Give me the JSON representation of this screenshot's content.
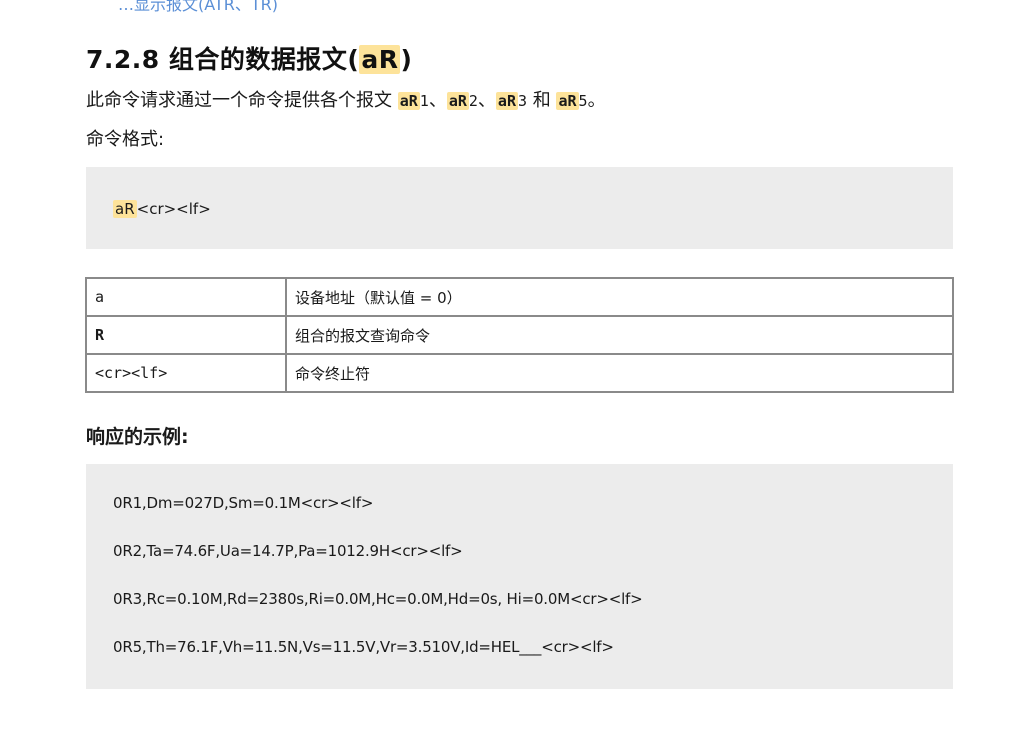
{
  "top_cut_text": "…显示报文(ATR、TR)",
  "heading": {
    "number": "7.2.8",
    "title_prefix": "组合的数据报文(",
    "title_code": "aR",
    "title_suffix": ")"
  },
  "intro": {
    "text": "此命令请求通过一个命令提供各个报文",
    "commands": [
      {
        "code": "aR",
        "num": "1",
        "sep": "、"
      },
      {
        "code": "aR",
        "num": "2",
        "sep": "、"
      },
      {
        "code": "aR",
        "num": "3",
        "sep": " 和 "
      },
      {
        "code": "aR",
        "num": "5",
        "sep": "。"
      }
    ]
  },
  "format_label": "命令格式:",
  "command_format": {
    "code": "aR",
    "rest": "<cr><lf>"
  },
  "params_table": [
    {
      "param": "a",
      "desc": "设备地址（默认值 = 0）"
    },
    {
      "param": "R",
      "desc": "组合的报文查询命令"
    },
    {
      "param": "<cr><lf>",
      "desc": "命令终止符"
    }
  ],
  "response_label": "响应的示例:",
  "response_lines": [
    "0R1,Dm=027D,Sm=0.1M<cr><lf>",
    "0R2,Ta=74.6F,Ua=14.7P,Pa=1012.9H<cr><lf>",
    "0R3,Rc=0.10M,Rd=2380s,Ri=0.0M,Hc=0.0M,Hd=0s, Hi=0.0M<cr><lf>",
    "0R5,Th=76.1F,Vh=11.5N,Vs=11.5V,Vr=3.510V,Id=HEL___<cr><lf>"
  ],
  "colors": {
    "highlight": "#fde39a",
    "code_background": "#ececec",
    "table_border": "#8a8a8a"
  }
}
